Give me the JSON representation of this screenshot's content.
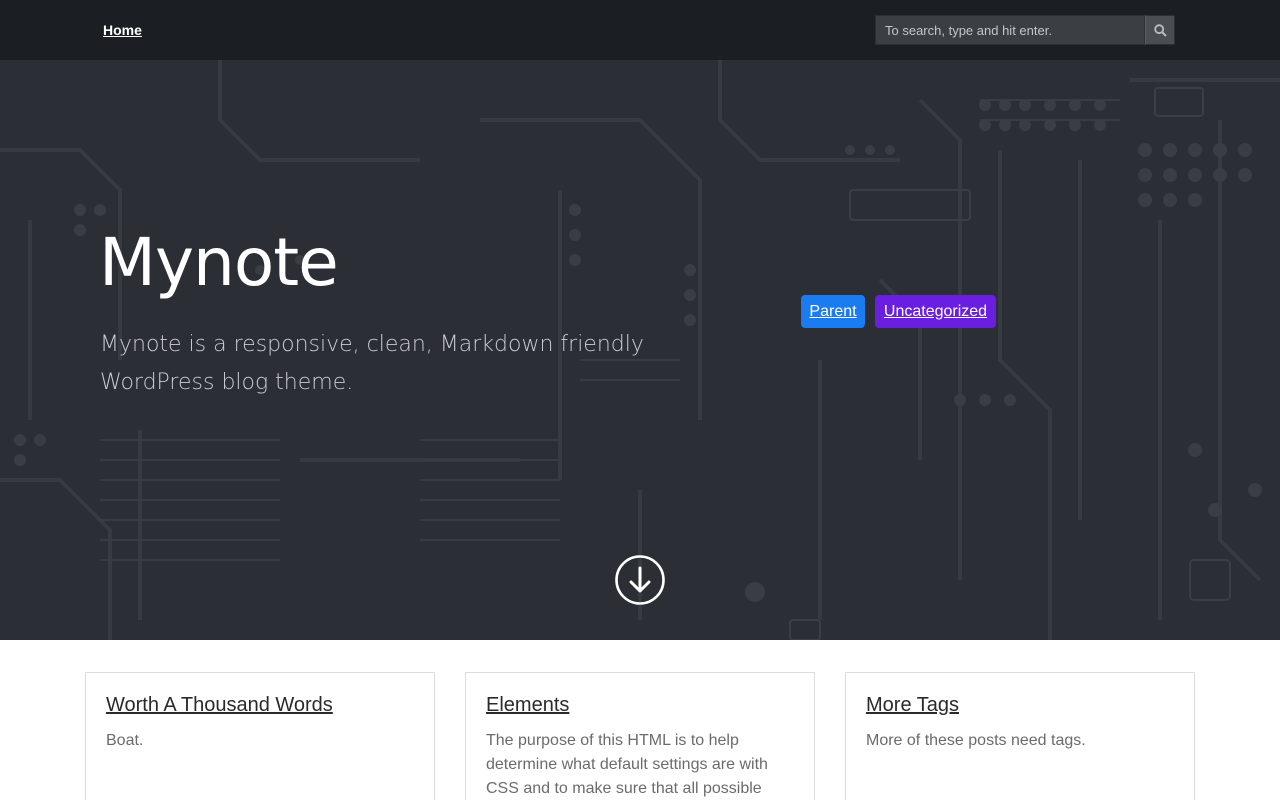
{
  "nav": {
    "home_label": "Home"
  },
  "search": {
    "placeholder": "To search, type and hit enter."
  },
  "hero": {
    "title": "Mynote",
    "description": "Mynote is a responsive, clean, Markdown friendly WordPress blog theme.",
    "tags": [
      {
        "label": "Parent",
        "color": "#1a7cf0"
      },
      {
        "label": "Uncategorized",
        "color": "#6a1fe0"
      }
    ]
  },
  "posts": [
    {
      "title": "Worth A Thousand Words",
      "excerpt": "Boat."
    },
    {
      "title": "Elements",
      "excerpt": "The purpose of this HTML is to help determine what default settings are with CSS and to make sure that all possible"
    },
    {
      "title": "More Tags",
      "excerpt": "More of these posts need tags."
    }
  ],
  "icons": [
    "search-icon",
    "arrow-down-circle-icon"
  ]
}
